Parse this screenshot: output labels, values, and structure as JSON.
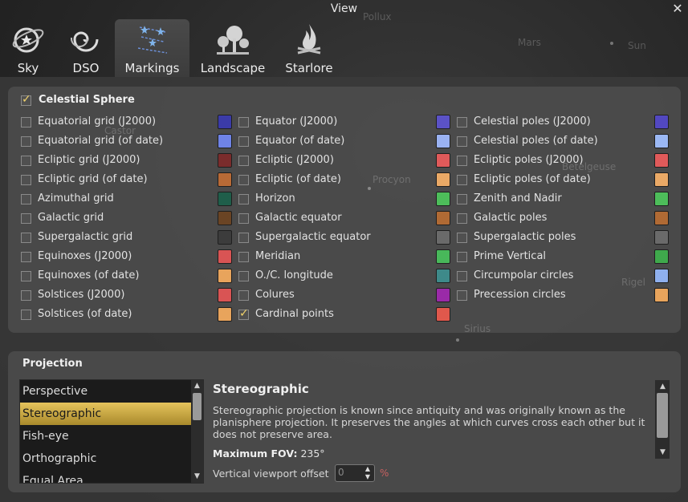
{
  "window": {
    "title": "View"
  },
  "sky_labels": [
    "Pollux",
    "Mars",
    "Sun",
    "Procyon",
    "Betelgeuse",
    "Rigel",
    "Sirius",
    "Castor"
  ],
  "tabs": [
    {
      "label": "Sky",
      "icon": "sky-icon"
    },
    {
      "label": "DSO",
      "icon": "dso-galaxy-icon"
    },
    {
      "label": "Markings",
      "icon": "markings-constellation-icon",
      "active": true
    },
    {
      "label": "Landscape",
      "icon": "landscape-trees-icon"
    },
    {
      "label": "Starlore",
      "icon": "starlore-campfire-icon"
    }
  ],
  "celestial": {
    "title": "Celestial Sphere",
    "checked": true,
    "col1": [
      {
        "label": "Equatorial grid (J2000)",
        "checked": false,
        "color": "#3b3ba8"
      },
      {
        "label": "Equatorial grid (of date)",
        "checked": false,
        "color": "#6f83e6"
      },
      {
        "label": "Ecliptic grid (J2000)",
        "checked": false,
        "color": "#7a2c2c"
      },
      {
        "label": "Ecliptic grid (of date)",
        "checked": false,
        "color": "#b86a36"
      },
      {
        "label": "Azimuthal grid",
        "checked": false,
        "color": "#1f5e4a"
      },
      {
        "label": "Galactic grid",
        "checked": false,
        "color": "#6a4424"
      },
      {
        "label": "Supergalactic grid",
        "checked": false,
        "color": "#3c3c3c"
      },
      {
        "label": "Equinoxes (J2000)",
        "checked": false,
        "color": "#d95454"
      },
      {
        "label": "Equinoxes (of date)",
        "checked": false,
        "color": "#e8a45c"
      },
      {
        "label": "Solstices (J2000)",
        "checked": false,
        "color": "#d95454"
      },
      {
        "label": "Solstices (of date)",
        "checked": false,
        "color": "#e8a45c"
      }
    ],
    "col2": [
      {
        "label": "Equator (J2000)",
        "checked": false,
        "color": "#5b52c6"
      },
      {
        "label": "Equator (of date)",
        "checked": false,
        "color": "#9ab2f2"
      },
      {
        "label": "Ecliptic (J2000)",
        "checked": false,
        "color": "#e05a5a"
      },
      {
        "label": "Ecliptic (of date)",
        "checked": false,
        "color": "#eaa966"
      },
      {
        "label": "Horizon",
        "checked": false,
        "color": "#4dbd5a"
      },
      {
        "label": "Galactic equator",
        "checked": false,
        "color": "#b06a34"
      },
      {
        "label": "Supergalactic equator",
        "checked": false,
        "color": "#6a6a6a"
      },
      {
        "label": "Meridian",
        "checked": false,
        "color": "#48b85a"
      },
      {
        "label": "O./C. longitude",
        "checked": false,
        "color": "#3e8a8a"
      },
      {
        "label": "Colures",
        "checked": false,
        "color": "#9a2aa8"
      },
      {
        "label": "Cardinal points",
        "checked": true,
        "color": "#e0584c"
      }
    ],
    "col3": [
      {
        "label": "Celestial poles (J2000)",
        "checked": false,
        "color": "#5248c0"
      },
      {
        "label": "Celestial poles (of date)",
        "checked": false,
        "color": "#9bb8f4"
      },
      {
        "label": "Ecliptic poles (J2000)",
        "checked": false,
        "color": "#e05a5a"
      },
      {
        "label": "Ecliptic poles (of date)",
        "checked": false,
        "color": "#eaa966"
      },
      {
        "label": "Zenith and Nadir",
        "checked": false,
        "color": "#4dbd5a"
      },
      {
        "label": "Galactic poles",
        "checked": false,
        "color": "#b06a34"
      },
      {
        "label": "Supergalactic poles",
        "checked": false,
        "color": "#6a6a6a"
      },
      {
        "label": "Prime Vertical",
        "checked": false,
        "color": "#3fa94c"
      },
      {
        "label": "Circumpolar circles",
        "checked": false,
        "color": "#8fb0ee"
      },
      {
        "label": "Precession circles",
        "checked": false,
        "color": "#e8a45c"
      }
    ]
  },
  "projection": {
    "title": "Projection",
    "items": [
      "Perspective",
      "Stereographic",
      "Fish-eye",
      "Orthographic",
      "Equal Area"
    ],
    "selected": "Stereographic",
    "detail": {
      "name": "Stereographic",
      "description": "Stereographic projection is known since antiquity and was originally known as the planisphere projection. It preserves the angles at which curves cross each other but it does not preserve area.",
      "fov_label": "Maximum FOV:",
      "fov_value": "235°",
      "offset_label": "Vertical viewport offset",
      "offset_value": "0",
      "offset_unit": "%"
    }
  }
}
